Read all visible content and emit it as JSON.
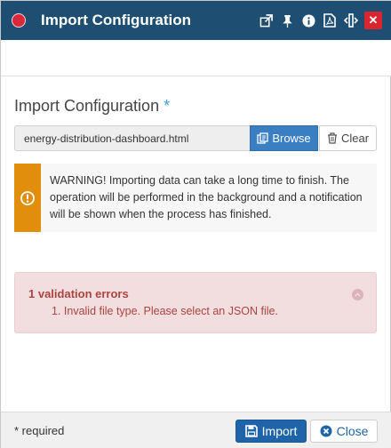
{
  "window": {
    "title": "Import Configuration",
    "icons": [
      "popout-icon",
      "pin-icon",
      "info-icon",
      "pdf-icon",
      "resize-horizontal-icon"
    ],
    "close_label": "✕"
  },
  "form": {
    "label": "Import Configuration",
    "required_marker": "*",
    "file_value": "energy-distribution-dashboard.html",
    "browse_label": "Browse",
    "clear_label": "Clear"
  },
  "warning": {
    "text": "WARNING! Importing data can take a long time to finish. The operation will be performed in the background and a notification will be shown when the process has finished."
  },
  "validation": {
    "title": "1 validation errors",
    "items": [
      "1. Invalid file type. Please select an JSON file."
    ]
  },
  "footer": {
    "required_note": "* required",
    "import_label": "Import",
    "close_label": "Close"
  },
  "colors": {
    "titlebar": "#1f4e73",
    "accent": "#3a7fc1",
    "warning": "#e08e0b",
    "error_bg": "#f2dede",
    "error_text": "#a94442"
  }
}
